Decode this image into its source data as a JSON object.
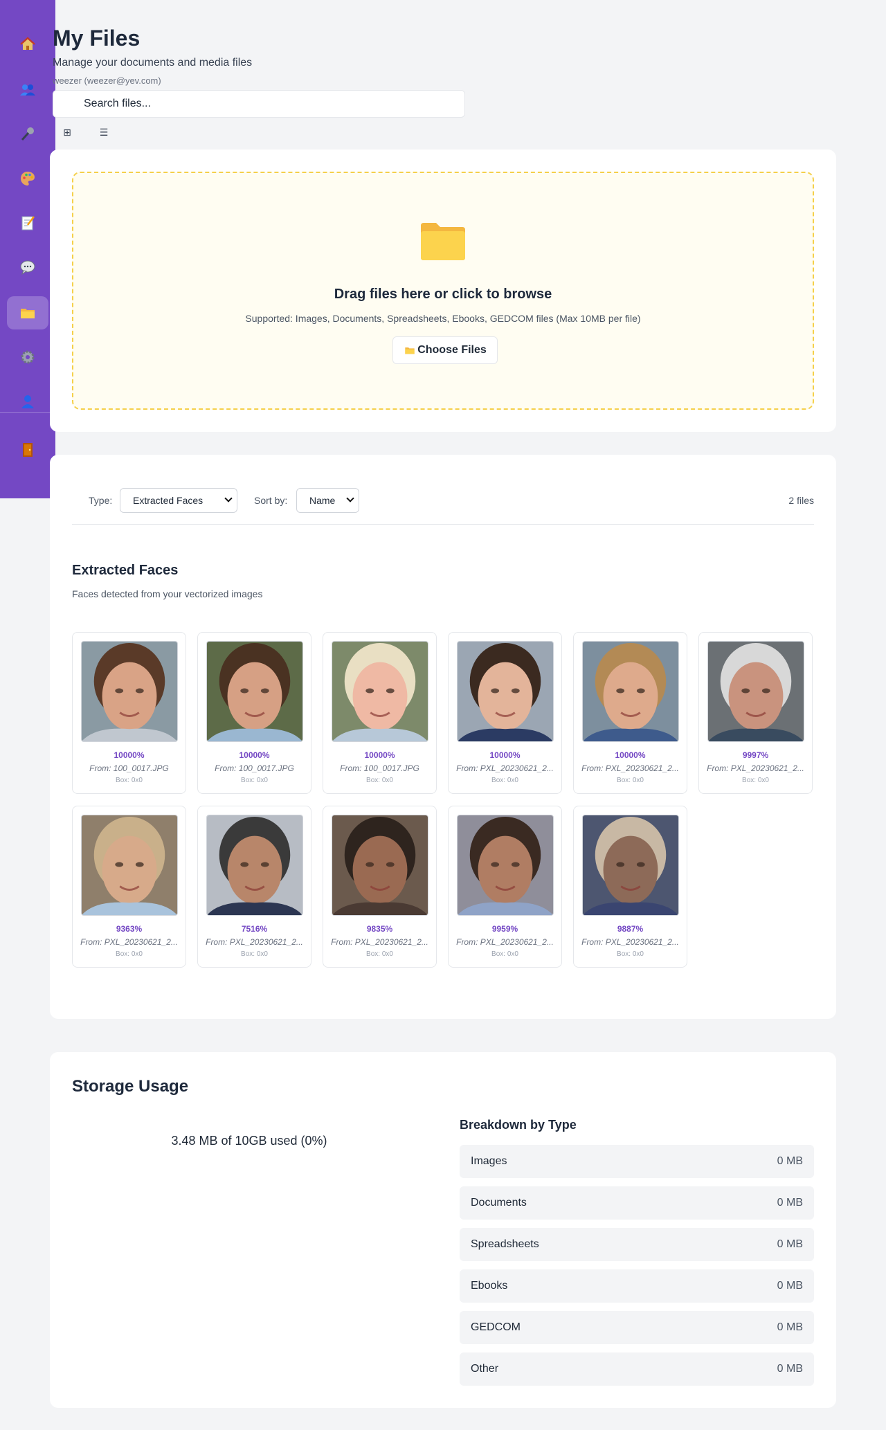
{
  "sidebar": {
    "items": [
      {
        "name": "home",
        "icon": "house-icon"
      },
      {
        "name": "people",
        "icon": "people-icon"
      },
      {
        "name": "microphone",
        "icon": "microphone-icon"
      },
      {
        "name": "art",
        "icon": "palette-icon"
      },
      {
        "name": "notes",
        "icon": "memo-icon"
      },
      {
        "name": "chat",
        "icon": "speech-bubble-icon"
      },
      {
        "name": "files",
        "icon": "folder-icon",
        "active": true
      },
      {
        "name": "settings",
        "icon": "gear-icon"
      },
      {
        "name": "profile",
        "icon": "user-icon"
      },
      {
        "name": "logout",
        "icon": "door-icon"
      }
    ],
    "color": "#7448c4"
  },
  "header": {
    "title": "My Files",
    "subtitle": "Manage your documents and media files",
    "user": "weezer (weezer@yev.com)"
  },
  "search": {
    "placeholder": "Search files..."
  },
  "view_toggle": {
    "grid_icon": "⊞",
    "list_icon": "☰"
  },
  "upload": {
    "icon": "folder-icon",
    "title": "Drag files here or click to browse",
    "supported": "Supported: Images, Documents, Spreadsheets, Ebooks, GEDCOM files (Max 10MB per file)",
    "button_label": "Choose Files"
  },
  "filters": {
    "type_label": "Type:",
    "type_value": "Extracted Faces",
    "sort_label": "Sort by:",
    "sort_value": "Name",
    "count": "2 files"
  },
  "faces_section": {
    "title": "Extracted Faces",
    "subtitle": "Faces detected from your vectorized images",
    "faces": [
      {
        "confidence": "10000%",
        "from": "From: 100_0017.JPG",
        "box": "Box: 0x0",
        "skin": "#d9a386",
        "hair": "#5a3a28",
        "bg": "#8a9aa3",
        "shirt": "#c0c7cf"
      },
      {
        "confidence": "10000%",
        "from": "From: 100_0017.JPG",
        "box": "Box: 0x0",
        "skin": "#d6a084",
        "hair": "#4a3222",
        "bg": "#5d6b48",
        "shirt": "#9ab7d1"
      },
      {
        "confidence": "10000%",
        "from": "From: 100_0017.JPG",
        "box": "Box: 0x0",
        "skin": "#efb9a4",
        "hair": "#e9dfc3",
        "bg": "#7d8a6a",
        "shirt": "#b7c8d8"
      },
      {
        "confidence": "10000%",
        "from": "From: PXL_20230621_2...",
        "box": "Box: 0x0",
        "skin": "#e3b49a",
        "hair": "#3b2a20",
        "bg": "#9ba6b3",
        "shirt": "#2b3b63"
      },
      {
        "confidence": "10000%",
        "from": "From: PXL_20230621_2...",
        "box": "Box: 0x0",
        "skin": "#deaa8c",
        "hair": "#b38a55",
        "bg": "#7d8f9e",
        "shirt": "#3e5b8c"
      },
      {
        "confidence": "9997%",
        "from": "From: PXL_20230621_2...",
        "box": "Box: 0x0",
        "skin": "#c9937e",
        "hair": "#d8d8d8",
        "bg": "#6b7074",
        "shirt": "#394b5f"
      },
      {
        "confidence": "9363%",
        "from": "From: PXL_20230621_2...",
        "box": "Box: 0x0",
        "skin": "#d7aa8a",
        "hair": "#c9b08a",
        "bg": "#8f7f6b",
        "shirt": "#a9c3dc"
      },
      {
        "confidence": "7516%",
        "from": "From: PXL_20230621_2...",
        "box": "Box: 0x0",
        "skin": "#b8866a",
        "hair": "#3a3a3a",
        "bg": "#b7bcc4",
        "shirt": "#2c3652"
      },
      {
        "confidence": "9835%",
        "from": "From: PXL_20230621_2...",
        "box": "Box: 0x0",
        "skin": "#9a6a52",
        "hair": "#2e241e",
        "bg": "#6b5a4d",
        "shirt": "#4a3a33"
      },
      {
        "confidence": "9959%",
        "from": "From: PXL_20230621_2...",
        "box": "Box: 0x0",
        "skin": "#b07d63",
        "hair": "#3a2a22",
        "bg": "#8f8e9a",
        "shirt": "#8fa3c7"
      },
      {
        "confidence": "9887%",
        "from": "From: PXL_20230621_2...",
        "box": "Box: 0x0",
        "skin": "#8d6a58",
        "hair": "#c8b8a4",
        "bg": "#4d5670",
        "shirt": "#3a4570"
      }
    ]
  },
  "storage": {
    "title": "Storage Usage",
    "used": "3.48 MB of 10GB used (0%)",
    "breakdown_title": "Breakdown by Type",
    "breakdown": [
      {
        "name": "Images",
        "value": "0 MB"
      },
      {
        "name": "Documents",
        "value": "0 MB"
      },
      {
        "name": "Spreadsheets",
        "value": "0 MB"
      },
      {
        "name": "Ebooks",
        "value": "0 MB"
      },
      {
        "name": "GEDCOM",
        "value": "0 MB"
      },
      {
        "name": "Other",
        "value": "0 MB"
      }
    ]
  }
}
